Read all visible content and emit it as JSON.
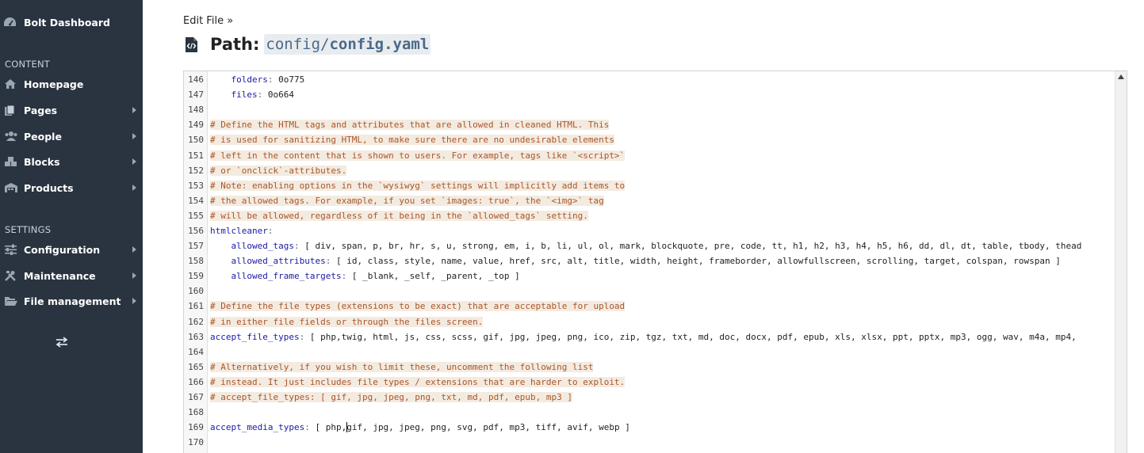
{
  "sidebar": {
    "brand": "Bolt Dashboard",
    "content_heading": "CONTENT",
    "settings_heading": "SETTINGS",
    "content_items": [
      {
        "label": "Homepage",
        "icon": "home-icon",
        "has_submenu": false
      },
      {
        "label": "Pages",
        "icon": "file-copy-icon",
        "has_submenu": true
      },
      {
        "label": "People",
        "icon": "users-icon",
        "has_submenu": true
      },
      {
        "label": "Blocks",
        "icon": "cubes-icon",
        "has_submenu": true
      },
      {
        "label": "Products",
        "icon": "warehouse-icon",
        "has_submenu": true
      }
    ],
    "settings_items": [
      {
        "label": "Configuration",
        "icon": "sliders-icon",
        "has_submenu": true
      },
      {
        "label": "Maintenance",
        "icon": "tools-icon",
        "has_submenu": true
      },
      {
        "label": "File management",
        "icon": "folder-open-icon",
        "has_submenu": true
      }
    ],
    "toggle_icon": "exchange-icon"
  },
  "header": {
    "breadcrumb": "Edit File »",
    "title_label": "Path:",
    "path_dir": "config/",
    "path_file": "config.yaml"
  },
  "editor": {
    "lines": [
      {
        "n": "146",
        "k": "    folders",
        "v": " 0o775"
      },
      {
        "n": "147",
        "k": "    files",
        "v": " 0o664"
      },
      {
        "n": "148",
        "c": ""
      },
      {
        "n": "149",
        "c": "# Define the HTML tags and attributes that are allowed in cleaned HTML. This"
      },
      {
        "n": "150",
        "c": "# is used for sanitizing HTML, to make sure there are no undesirable elements"
      },
      {
        "n": "151",
        "c": "# left in the content that is shown to users. For example, tags like `<script>`"
      },
      {
        "n": "152",
        "c": "# or `onclick`-attributes."
      },
      {
        "n": "153",
        "c": "# Note: enabling options in the `wysiwyg` settings will implicitly add items to"
      },
      {
        "n": "154",
        "c": "# the allowed tags. For example, if you set `images: true`, the `<img>` tag"
      },
      {
        "n": "155",
        "c": "# will be allowed, regardless of it being in the `allowed_tags` setting."
      },
      {
        "n": "156",
        "k": "htmlcleaner",
        "v": ""
      },
      {
        "n": "157",
        "k": "    allowed_tags",
        "v": " [ div, span, p, br, hr, s, u, strong, em, i, b, li, ul, ol, mark, blockquote, pre, code, tt, h1, h2, h3, h4, h5, h6, dd, dl, dt, table, tbody, thead"
      },
      {
        "n": "158",
        "k": "    allowed_attributes",
        "v": " [ id, class, style, name, value, href, src, alt, title, width, height, frameborder, allowfullscreen, scrolling, target, colspan, rowspan ]"
      },
      {
        "n": "159",
        "k": "    allowed_frame_targets",
        "v": " [ _blank, _self, _parent, _top ]"
      },
      {
        "n": "160",
        "c": ""
      },
      {
        "n": "161",
        "c": "# Define the file types (extensions to be exact) that are acceptable for upload"
      },
      {
        "n": "162",
        "c": "# in either file fields or through the files screen."
      },
      {
        "n": "163",
        "k": "accept_file_types",
        "v": " [ php,twig, html, js, css, scss, gif, jpg, jpeg, png, ico, zip, tgz, txt, md, doc, docx, pdf, epub, xls, xlsx, ppt, pptx, mp3, ogg, wav, m4a, mp4,"
      },
      {
        "n": "164",
        "c": ""
      },
      {
        "n": "165",
        "c": "# Alternatively, if you wish to limit these, uncomment the following list"
      },
      {
        "n": "166",
        "c": "# instead. It just includes file types / extensions that are harder to exploit."
      },
      {
        "n": "167",
        "c": "# accept_file_types: [ gif, jpg, jpeg, png, txt, md, pdf, epub, mp3 ]"
      },
      {
        "n": "168",
        "c": ""
      },
      {
        "n": "169",
        "k": "accept_media_types",
        "v": " [ php,",
        "v2": "gif, jpg, jpeg, png, svg, pdf, mp3, tiff, avif, webp ]"
      },
      {
        "n": "170",
        "c": ""
      }
    ]
  }
}
